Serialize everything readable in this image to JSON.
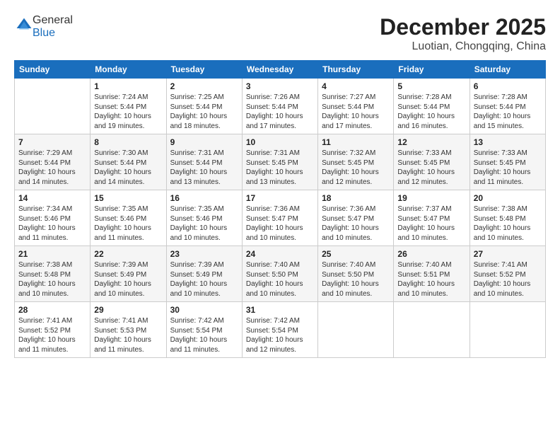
{
  "logo": {
    "general": "General",
    "blue": "Blue"
  },
  "header": {
    "month": "December 2025",
    "location": "Luotian, Chongqing, China"
  },
  "weekdays": [
    "Sunday",
    "Monday",
    "Tuesday",
    "Wednesday",
    "Thursday",
    "Friday",
    "Saturday"
  ],
  "weeks": [
    [
      {
        "day": "",
        "info": ""
      },
      {
        "day": "1",
        "info": "Sunrise: 7:24 AM\nSunset: 5:44 PM\nDaylight: 10 hours\nand 19 minutes."
      },
      {
        "day": "2",
        "info": "Sunrise: 7:25 AM\nSunset: 5:44 PM\nDaylight: 10 hours\nand 18 minutes."
      },
      {
        "day": "3",
        "info": "Sunrise: 7:26 AM\nSunset: 5:44 PM\nDaylight: 10 hours\nand 17 minutes."
      },
      {
        "day": "4",
        "info": "Sunrise: 7:27 AM\nSunset: 5:44 PM\nDaylight: 10 hours\nand 17 minutes."
      },
      {
        "day": "5",
        "info": "Sunrise: 7:28 AM\nSunset: 5:44 PM\nDaylight: 10 hours\nand 16 minutes."
      },
      {
        "day": "6",
        "info": "Sunrise: 7:28 AM\nSunset: 5:44 PM\nDaylight: 10 hours\nand 15 minutes."
      }
    ],
    [
      {
        "day": "7",
        "info": "Sunrise: 7:29 AM\nSunset: 5:44 PM\nDaylight: 10 hours\nand 14 minutes."
      },
      {
        "day": "8",
        "info": "Sunrise: 7:30 AM\nSunset: 5:44 PM\nDaylight: 10 hours\nand 14 minutes."
      },
      {
        "day": "9",
        "info": "Sunrise: 7:31 AM\nSunset: 5:44 PM\nDaylight: 10 hours\nand 13 minutes."
      },
      {
        "day": "10",
        "info": "Sunrise: 7:31 AM\nSunset: 5:45 PM\nDaylight: 10 hours\nand 13 minutes."
      },
      {
        "day": "11",
        "info": "Sunrise: 7:32 AM\nSunset: 5:45 PM\nDaylight: 10 hours\nand 12 minutes."
      },
      {
        "day": "12",
        "info": "Sunrise: 7:33 AM\nSunset: 5:45 PM\nDaylight: 10 hours\nand 12 minutes."
      },
      {
        "day": "13",
        "info": "Sunrise: 7:33 AM\nSunset: 5:45 PM\nDaylight: 10 hours\nand 11 minutes."
      }
    ],
    [
      {
        "day": "14",
        "info": "Sunrise: 7:34 AM\nSunset: 5:46 PM\nDaylight: 10 hours\nand 11 minutes."
      },
      {
        "day": "15",
        "info": "Sunrise: 7:35 AM\nSunset: 5:46 PM\nDaylight: 10 hours\nand 11 minutes."
      },
      {
        "day": "16",
        "info": "Sunrise: 7:35 AM\nSunset: 5:46 PM\nDaylight: 10 hours\nand 10 minutes."
      },
      {
        "day": "17",
        "info": "Sunrise: 7:36 AM\nSunset: 5:47 PM\nDaylight: 10 hours\nand 10 minutes."
      },
      {
        "day": "18",
        "info": "Sunrise: 7:36 AM\nSunset: 5:47 PM\nDaylight: 10 hours\nand 10 minutes."
      },
      {
        "day": "19",
        "info": "Sunrise: 7:37 AM\nSunset: 5:47 PM\nDaylight: 10 hours\nand 10 minutes."
      },
      {
        "day": "20",
        "info": "Sunrise: 7:38 AM\nSunset: 5:48 PM\nDaylight: 10 hours\nand 10 minutes."
      }
    ],
    [
      {
        "day": "21",
        "info": "Sunrise: 7:38 AM\nSunset: 5:48 PM\nDaylight: 10 hours\nand 10 minutes."
      },
      {
        "day": "22",
        "info": "Sunrise: 7:39 AM\nSunset: 5:49 PM\nDaylight: 10 hours\nand 10 minutes."
      },
      {
        "day": "23",
        "info": "Sunrise: 7:39 AM\nSunset: 5:49 PM\nDaylight: 10 hours\nand 10 minutes."
      },
      {
        "day": "24",
        "info": "Sunrise: 7:40 AM\nSunset: 5:50 PM\nDaylight: 10 hours\nand 10 minutes."
      },
      {
        "day": "25",
        "info": "Sunrise: 7:40 AM\nSunset: 5:50 PM\nDaylight: 10 hours\nand 10 minutes."
      },
      {
        "day": "26",
        "info": "Sunrise: 7:40 AM\nSunset: 5:51 PM\nDaylight: 10 hours\nand 10 minutes."
      },
      {
        "day": "27",
        "info": "Sunrise: 7:41 AM\nSunset: 5:52 PM\nDaylight: 10 hours\nand 10 minutes."
      }
    ],
    [
      {
        "day": "28",
        "info": "Sunrise: 7:41 AM\nSunset: 5:52 PM\nDaylight: 10 hours\nand 11 minutes."
      },
      {
        "day": "29",
        "info": "Sunrise: 7:41 AM\nSunset: 5:53 PM\nDaylight: 10 hours\nand 11 minutes."
      },
      {
        "day": "30",
        "info": "Sunrise: 7:42 AM\nSunset: 5:54 PM\nDaylight: 10 hours\nand 11 minutes."
      },
      {
        "day": "31",
        "info": "Sunrise: 7:42 AM\nSunset: 5:54 PM\nDaylight: 10 hours\nand 12 minutes."
      },
      {
        "day": "",
        "info": ""
      },
      {
        "day": "",
        "info": ""
      },
      {
        "day": "",
        "info": ""
      }
    ]
  ]
}
